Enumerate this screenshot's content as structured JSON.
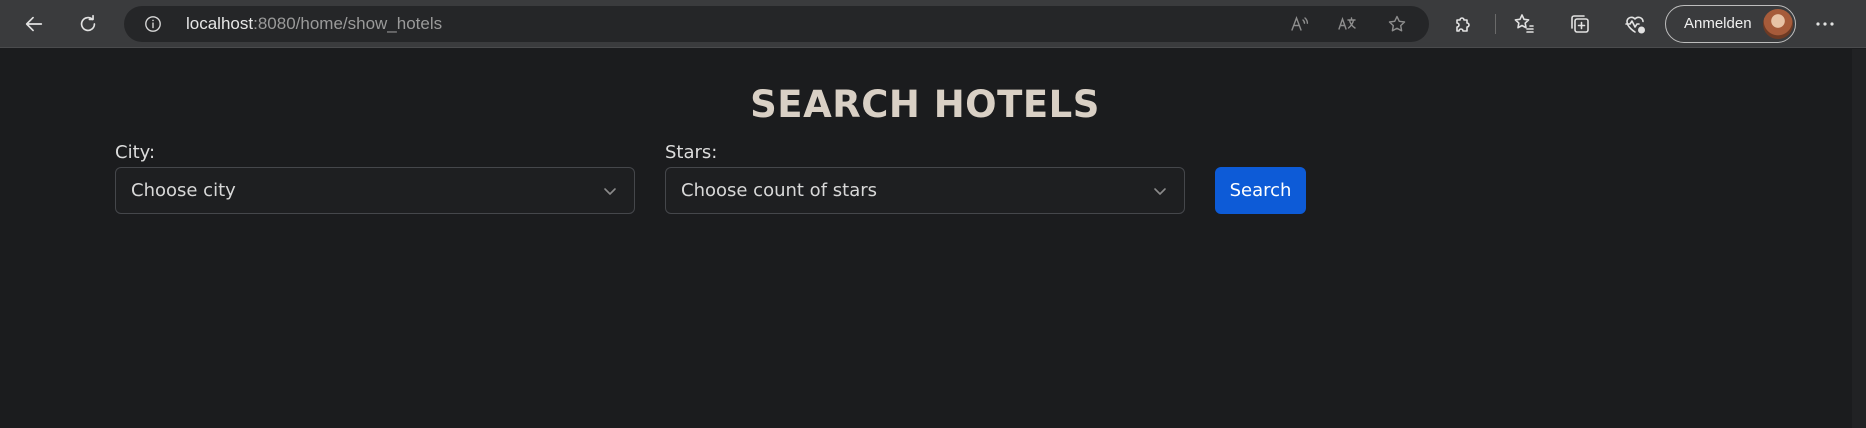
{
  "browser": {
    "url_host": "localhost",
    "url_path": ":8080/home/show_hotels",
    "signin_label": "Anmelden",
    "icons": {
      "back": "arrow-left-icon",
      "reload": "refresh-icon",
      "info": "info-icon",
      "read_aloud": "read-aloud-icon",
      "translate": "translate-icon",
      "favorite": "star-icon",
      "extensions": "puzzle-icon",
      "favorites": "favorites-icon",
      "collections": "collections-icon",
      "performance": "heart-pulse-icon",
      "more": "more-icon"
    }
  },
  "page": {
    "title": "SEARCH HOTELS",
    "city": {
      "label": "City:",
      "selected": "Choose city"
    },
    "stars": {
      "label": "Stars:",
      "selected": "Choose count of stars"
    },
    "search_button": "Search"
  },
  "colors": {
    "page_background": "#1b1c1e",
    "chrome_background": "#3a3b3d",
    "title": "#d9d0c5",
    "button": "#0d5bd7"
  }
}
